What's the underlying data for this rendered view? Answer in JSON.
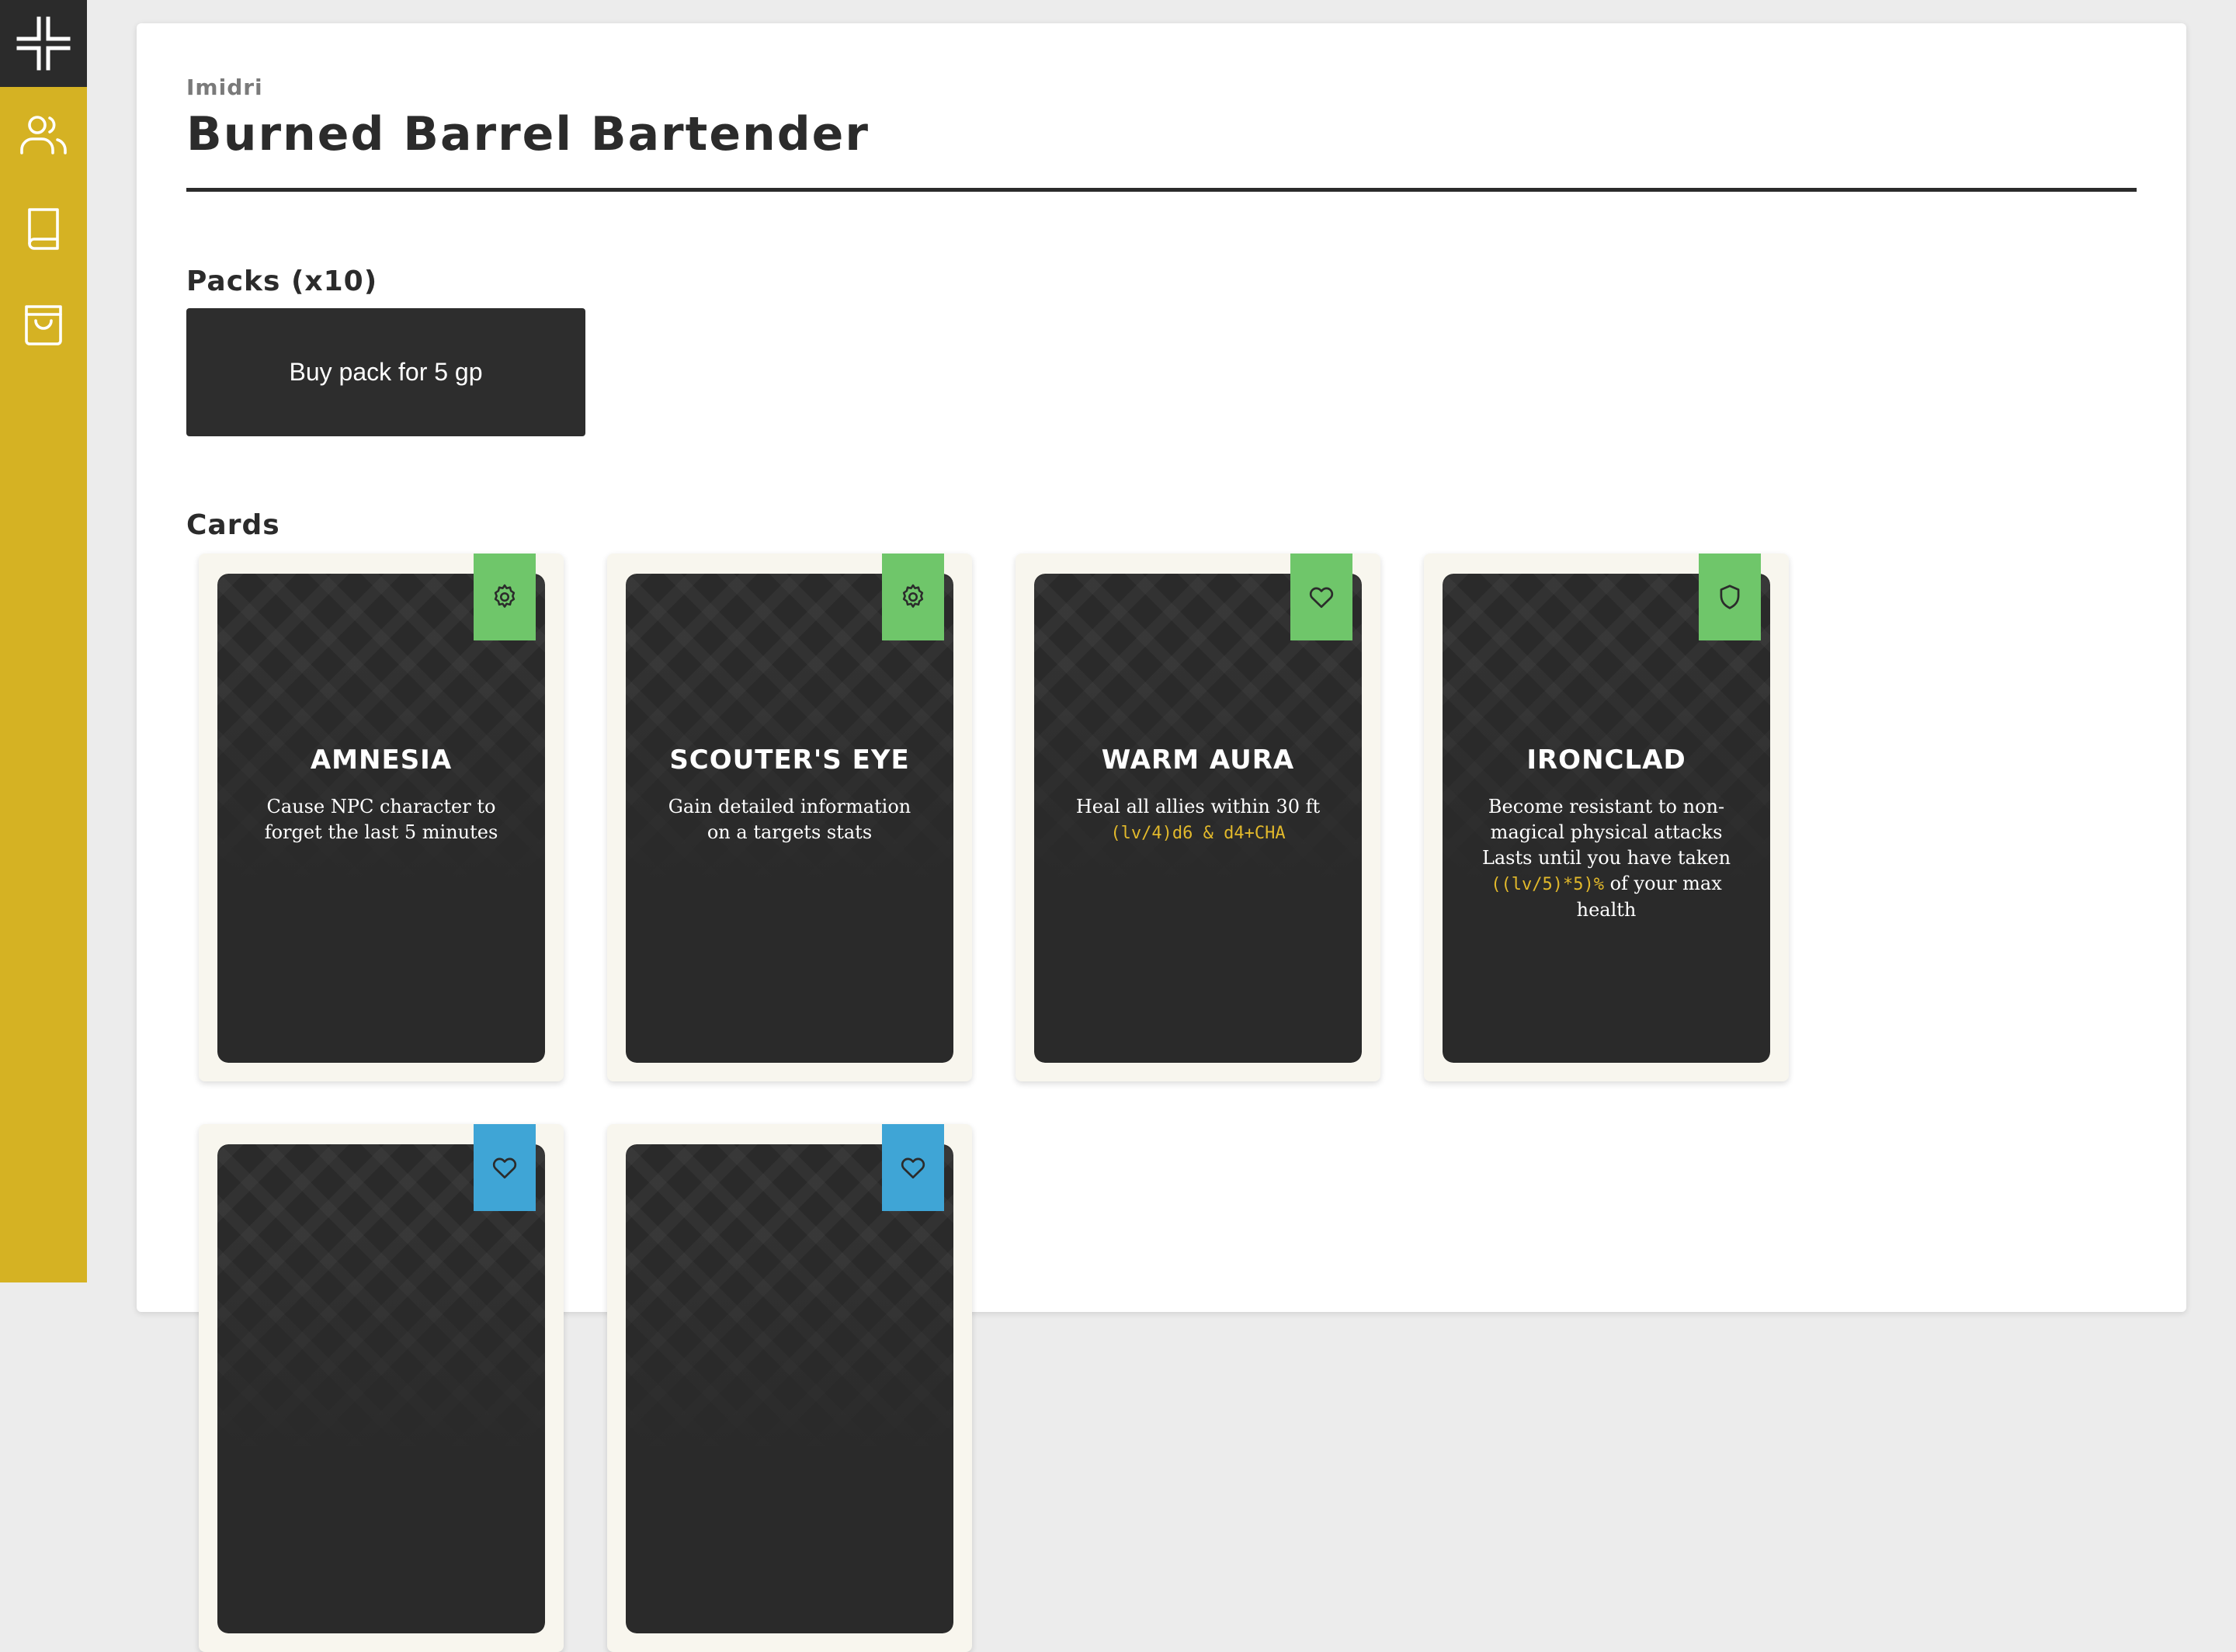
{
  "colors": {
    "sidebar": "#d5b223",
    "dark": "#2b2b2b",
    "tag_green": "#6fc66a",
    "tag_blue": "#3fa5d6",
    "formula": "#e2b92b"
  },
  "sidebar": {
    "logo_icon": "cross-logo-icon",
    "items": [
      {
        "icon": "users-icon"
      },
      {
        "icon": "book-icon"
      },
      {
        "icon": "shopping-bag-icon"
      }
    ]
  },
  "header": {
    "owner": "Imidri",
    "title": "Burned Barrel Bartender"
  },
  "packs": {
    "heading": "Packs (x10)",
    "buy_label": "Buy pack for 5 gp"
  },
  "cards_section": {
    "heading": "Cards",
    "cards": [
      {
        "name": "AMNESIA",
        "desc": "Cause NPC character to forget the last 5 minutes",
        "formula": "",
        "desc_after": "",
        "icon": "gear-icon",
        "tag_color": "green"
      },
      {
        "name": "SCOUTER'S EYE",
        "desc": "Gain detailed information on a targets stats",
        "formula": "",
        "desc_after": "",
        "icon": "gear-icon",
        "tag_color": "green"
      },
      {
        "name": "WARM AURA",
        "desc": "Heal all allies within 30 ft",
        "formula": "(lv/4)d6 & d4+CHA",
        "desc_after": "",
        "icon": "heart-icon",
        "tag_color": "green"
      },
      {
        "name": "IRONCLAD",
        "desc": "Become resistant to non-magical physical attacks Lasts until you have taken",
        "formula": "((lv/5)*5)%",
        "desc_after": "of your max health",
        "icon": "shield-icon",
        "tag_color": "green"
      },
      {
        "name": "",
        "desc": "",
        "formula": "",
        "desc_after": "",
        "icon": "heart-icon",
        "tag_color": "blue"
      },
      {
        "name": "",
        "desc": "",
        "formula": "",
        "desc_after": "",
        "icon": "heart-icon",
        "tag_color": "blue"
      }
    ]
  }
}
